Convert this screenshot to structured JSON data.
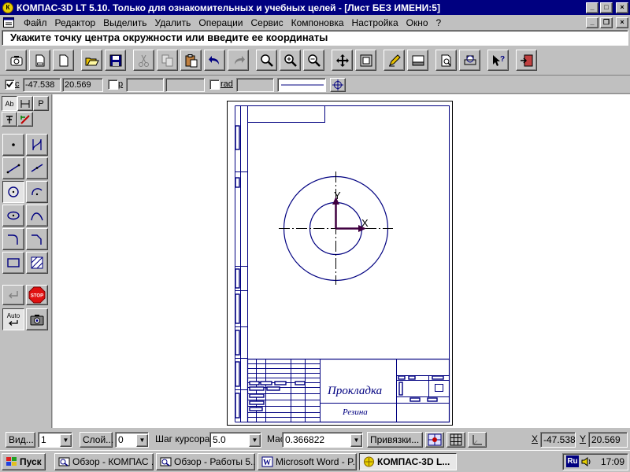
{
  "window": {
    "title": "КОМПАС-3D LT 5.10. Только для ознакомительных и учебных целей - [Лист БЕЗ ИМЕНИ:5]",
    "doc_title": "Лист БЕЗ ИМЕНИ:5"
  },
  "menu": [
    "Файл",
    "Редактор",
    "Выделить",
    "Удалить",
    "Операции",
    "Сервис",
    "Компоновка",
    "Настройка",
    "Окно",
    "?"
  ],
  "prompt": "Укажите точку центра окружности или введите ее координаты",
  "toolbar": {
    "icons": [
      "snapshot-icon",
      "new-sheet-icon",
      "new-fragment-icon",
      "open-icon",
      "save-icon",
      "cut-icon",
      "copy-icon",
      "paste-icon",
      "undo-icon",
      "redo-icon",
      "zoom-window-icon",
      "zoom-in-icon",
      "zoom-out-icon",
      "pan-icon",
      "zoom-all-icon",
      "edit-icon",
      "view-manager-icon",
      "print-preview-icon",
      "print-icon",
      "help-icon",
      "exit-icon"
    ]
  },
  "coord_bar": {
    "c_label": "c",
    "x_value": "-47.538",
    "y_value": "20.569",
    "p_label": "p",
    "rad_label": "rad"
  },
  "left_panel": {
    "tabs": [
      "Ab",
      "Р"
    ],
    "tools": [
      "point-tool",
      "auxiliary-line-tool",
      "segment-tool",
      "parallel-segment-tool",
      "circle-tool",
      "arc-tool",
      "ellipse-tool",
      "spline-tool",
      "fillet-tool",
      "chamfer-tool",
      "rectangle-tool",
      "hatch-tool"
    ],
    "stop_label": "STOP",
    "auto_label": "Auto"
  },
  "drawing": {
    "part_name": "Прокладка",
    "material": "Резина",
    "axis_x": "X",
    "axis_y": "Y"
  },
  "status_bar": {
    "view_label": "Вид...",
    "view_value": "1",
    "layer_label": "Слой...",
    "layer_value": "0",
    "step_label": "Шаг курсора",
    "step_value": "5.0",
    "scale_label": "Масштаб",
    "scale_value": "0.366822",
    "snap_label": "Привязки...",
    "x_label": "X",
    "x_value": "-47.538",
    "y_label": "Y",
    "y_value": "20.569"
  },
  "taskbar": {
    "start_label": "Пуск",
    "tasks": [
      "Обзор - КОМПАС ...",
      "Обзор - Работы 5...",
      "Microsoft Word - P...",
      "КОМПАС-3D L..."
    ],
    "lang": "Ru",
    "clock": "17:09"
  },
  "colors": {
    "titlebar": "#000080",
    "window_bg": "#c0c0c0",
    "drawing_lines": "#000080",
    "axis_arrows": "#400040"
  }
}
